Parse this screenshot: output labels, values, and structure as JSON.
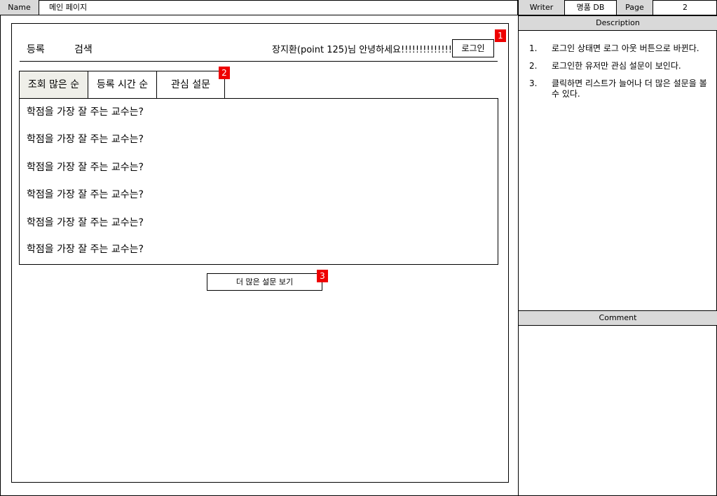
{
  "header": {
    "name_label": "Name",
    "name_value": "메인 페이지",
    "writer_label": "Writer",
    "writer_value": "명품 DB",
    "page_label": "Page",
    "page_value": "2"
  },
  "description": {
    "title": "Description",
    "items": [
      {
        "num": "1.",
        "text": "로그인 상태면 로그 아웃 버튼으로 바뀐다."
      },
      {
        "num": "2.",
        "text": "로그인한 유저만 관심 설문이 보인다."
      },
      {
        "num": "3.",
        "text": "클릭하면 리스트가 늘어나 더 많은 설문을 볼 수 있다."
      }
    ]
  },
  "comment": {
    "title": "Comment"
  },
  "mockup": {
    "nav": {
      "register": "등록",
      "search": "검색"
    },
    "greeting": "장지환(point 125)님 안녕하세요!!!!!!!!!!!!!!!",
    "login_button": "로그인",
    "tabs": [
      "조회 많은 순",
      "등록 시간 순",
      "관심 설문"
    ],
    "list_items": [
      "학점을 가장 잘 주는 교수는?",
      "학점을 가장 잘 주는 교수는?",
      "학점을 가장 잘 주는 교수는?",
      "학점을 가장 잘 주는 교수는?",
      "학점을 가장 잘 주는 교수는?",
      "학점을 가장 잘 주는 교수는?"
    ],
    "more_button": "더 많은 설문 보기",
    "badges": [
      "1",
      "2",
      "3"
    ]
  }
}
